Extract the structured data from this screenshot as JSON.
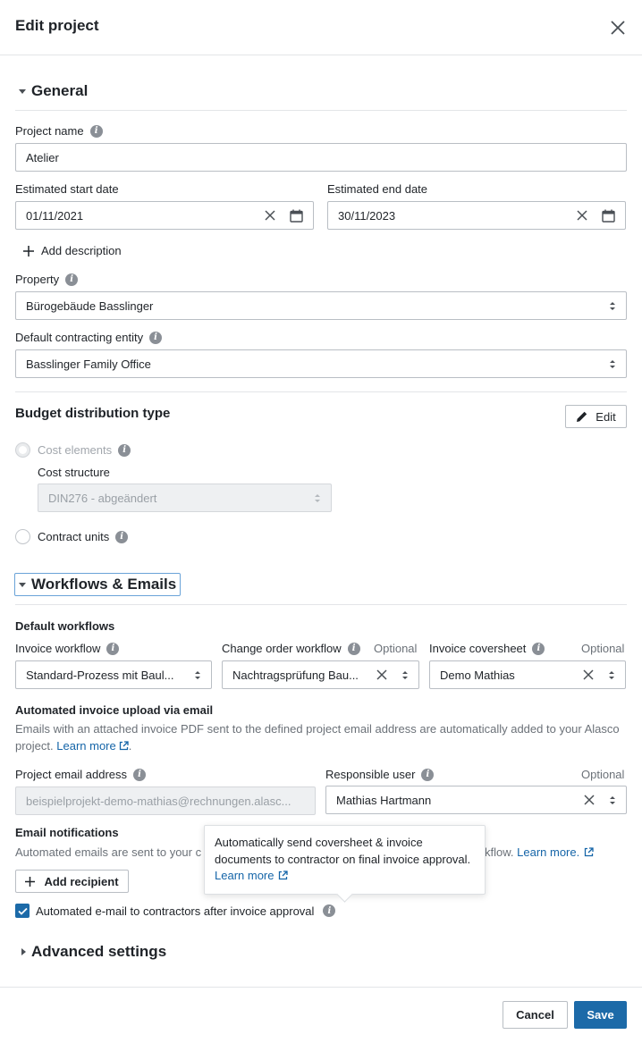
{
  "header": {
    "title": "Edit project"
  },
  "general": {
    "title": "General",
    "project_name": {
      "label": "Project name",
      "value": "Atelier"
    },
    "start_date": {
      "label": "Estimated start date",
      "value": "01/11/2021"
    },
    "end_date": {
      "label": "Estimated end date",
      "value": "30/11/2023"
    },
    "add_description": "Add description",
    "property": {
      "label": "Property",
      "value": "Bürogebäude Basslinger"
    },
    "contracting_entity": {
      "label": "Default contracting entity",
      "value": "Basslinger Family Office"
    }
  },
  "budget": {
    "title": "Budget distribution type",
    "edit_label": "Edit",
    "cost_elements": "Cost elements",
    "cost_structure": {
      "label": "Cost structure",
      "value": "DIN276 - abgeändert"
    },
    "contract_units": "Contract units"
  },
  "workflows": {
    "title": "Workflows & Emails",
    "default_workflows": "Default workflows",
    "invoice_workflow": {
      "label": "Invoice workflow",
      "value": "Standard-Prozess mit Baul..."
    },
    "change_order_workflow": {
      "label": "Change order workflow",
      "optional": "Optional",
      "value": "Nachtragsprüfung Bau..."
    },
    "invoice_coversheet": {
      "label": "Invoice coversheet",
      "optional": "Optional",
      "value": "Demo Mathias"
    },
    "auto_upload_title": "Automated invoice upload via email",
    "auto_upload_desc": "Emails with an attached invoice PDF sent to the defined project email address are automatically added to your Alasco project.",
    "learn_more": "Learn more",
    "project_email": {
      "label": "Project email address",
      "value": "beispielprojekt-demo-mathias@rechnungen.alasc..."
    },
    "responsible_user": {
      "label": "Responsible user",
      "optional": "Optional",
      "value": "Mathias Hartmann"
    },
    "email_notifications_title": "Email notifications",
    "email_notifications_desc_start": "Automated emails are sent to your c",
    "email_notifications_desc_end": "kflow.",
    "learn_more_dot": "Learn more.",
    "add_recipient": "Add recipient",
    "auto_email_label": "Automated e-mail to contractors after invoice approval"
  },
  "tooltip": {
    "text": "Automatically send coversheet & invoice documents to contractor on final invoice approval.",
    "learn_more": "Learn more"
  },
  "advanced": {
    "title": "Advanced settings"
  },
  "footer": {
    "cancel": "Cancel",
    "save": "Save"
  },
  "colors": {
    "primary": "#1c6aa8",
    "link": "#1565a8"
  }
}
